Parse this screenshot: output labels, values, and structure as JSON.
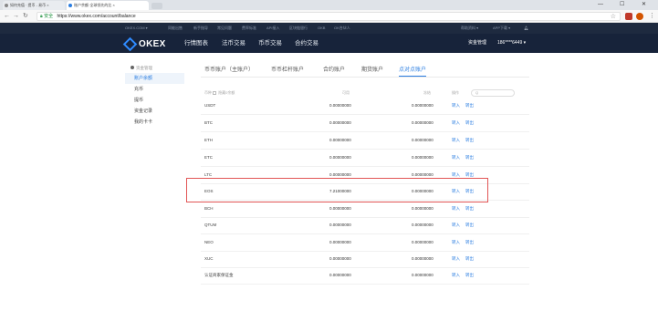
{
  "browser": {
    "tabs": [
      {
        "label": "如何充值 · 提币 - 易币 ×",
        "active": false
      },
      {
        "label": "账户余额·全球领先的比 ×",
        "active": true
      }
    ],
    "window_controls": [
      "—",
      "☐",
      "✕"
    ],
    "address": {
      "secure_label": "安全",
      "url": "https://www.okex.com/account/balance"
    }
  },
  "site": {
    "top_links": [
      "OKEX.COM ▾",
      "同能出售",
      "新手指导",
      "常见问题",
      "费率标准",
      "API接入",
      "区块链银行",
      "OKB",
      "OK合伙人",
      "帮助资料 ▾",
      "APP下载 ▾"
    ],
    "logo_text": "OKEX",
    "nav": [
      "行情图表",
      "法币交易",
      "币币交易",
      "合约交易"
    ],
    "nav_right": {
      "funds": "资金管理",
      "user": "186****6449 ▾"
    }
  },
  "sidebar": {
    "title": "资金管理",
    "items": [
      "账户余额",
      "充币",
      "提币",
      "资金记录",
      "我的卡卡"
    ]
  },
  "tabs": [
    "币币账户（主账户）",
    "币币杠杆账户",
    "合约账户",
    "期货账户",
    "点对点账户"
  ],
  "table": {
    "headers": {
      "currency": "币种",
      "hide_zero": "隐藏0余额",
      "available": "可用",
      "frozen": "冻结",
      "operation": "操作"
    },
    "search_placeholder": "Q",
    "rows": [
      {
        "currency": "USDT",
        "available": "0.00000000",
        "frozen": "0.00000000",
        "op1": "转入",
        "op2": "转出"
      },
      {
        "currency": "BTC",
        "available": "0.00000000",
        "frozen": "0.00000000",
        "op1": "转入",
        "op2": "转出"
      },
      {
        "currency": "ETH",
        "available": "0.00000000",
        "frozen": "0.00000000",
        "op1": "转入",
        "op2": "转出"
      },
      {
        "currency": "ETC",
        "available": "0.00000000",
        "frozen": "0.00000000",
        "op1": "转入",
        "op2": "转出"
      },
      {
        "currency": "LTC",
        "available": "0.00000000",
        "frozen": "0.00000000",
        "op1": "转入",
        "op2": "转出"
      },
      {
        "currency": "EOS",
        "available": "7.21000000",
        "frozen": "0.00000000",
        "op1": "转入",
        "op2": "转出"
      },
      {
        "currency": "BCH",
        "available": "0.00000000",
        "frozen": "0.00000000",
        "op1": "转入",
        "op2": "转出"
      },
      {
        "currency": "QTUM",
        "available": "0.00000000",
        "frozen": "0.00000000",
        "op1": "转入",
        "op2": "转出"
      },
      {
        "currency": "NEO",
        "available": "0.00000000",
        "frozen": "0.00000000",
        "op1": "转入",
        "op2": "转出"
      },
      {
        "currency": "XUC",
        "available": "0.00000000",
        "frozen": "0.00000000",
        "op1": "转入",
        "op2": "转出"
      },
      {
        "currency": "认证商家保证金",
        "available": "0.00000000",
        "frozen": "0.00000000",
        "op1": "转入",
        "op2": "转出"
      }
    ]
  },
  "colors": {
    "header_bg": "#17233a",
    "accent": "#2a7de1",
    "highlight": "#e25555"
  }
}
